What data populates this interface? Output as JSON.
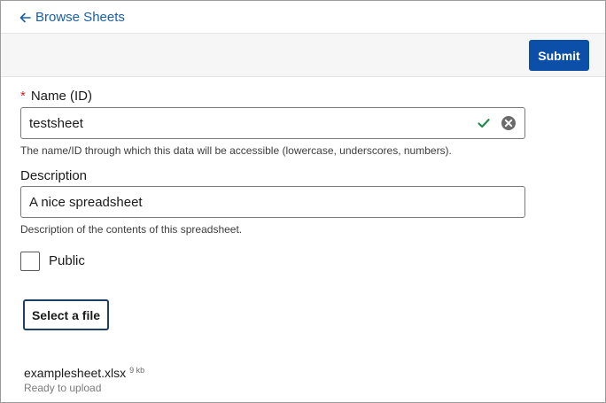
{
  "header": {
    "back_link": "Browse Sheets",
    "back_icon": "arrow-left-icon"
  },
  "toolbar": {
    "submit_label": "Submit",
    "submit_color": "#0b4fa8"
  },
  "form": {
    "name": {
      "required_mark": "*",
      "label": "Name (ID)",
      "value": "testsheet",
      "hint": "The name/ID through which this data will be accessible (lowercase, underscores, numbers).",
      "valid_icon": "check-icon",
      "clear_icon": "clear-circle-icon"
    },
    "description": {
      "label": "Description",
      "value": "A nice spreadsheet",
      "hint": "Description of the contents of this spreadsheet."
    },
    "public": {
      "label": "Public",
      "checked": false
    },
    "file_button_label": "Select a file"
  },
  "upload": {
    "file_name": "examplesheet.xlsx",
    "file_size": "9 kb",
    "status": "Ready to upload"
  },
  "colors": {
    "link": "#1a5fa8",
    "valid": "#1f8a4c",
    "required": "#c62828"
  }
}
